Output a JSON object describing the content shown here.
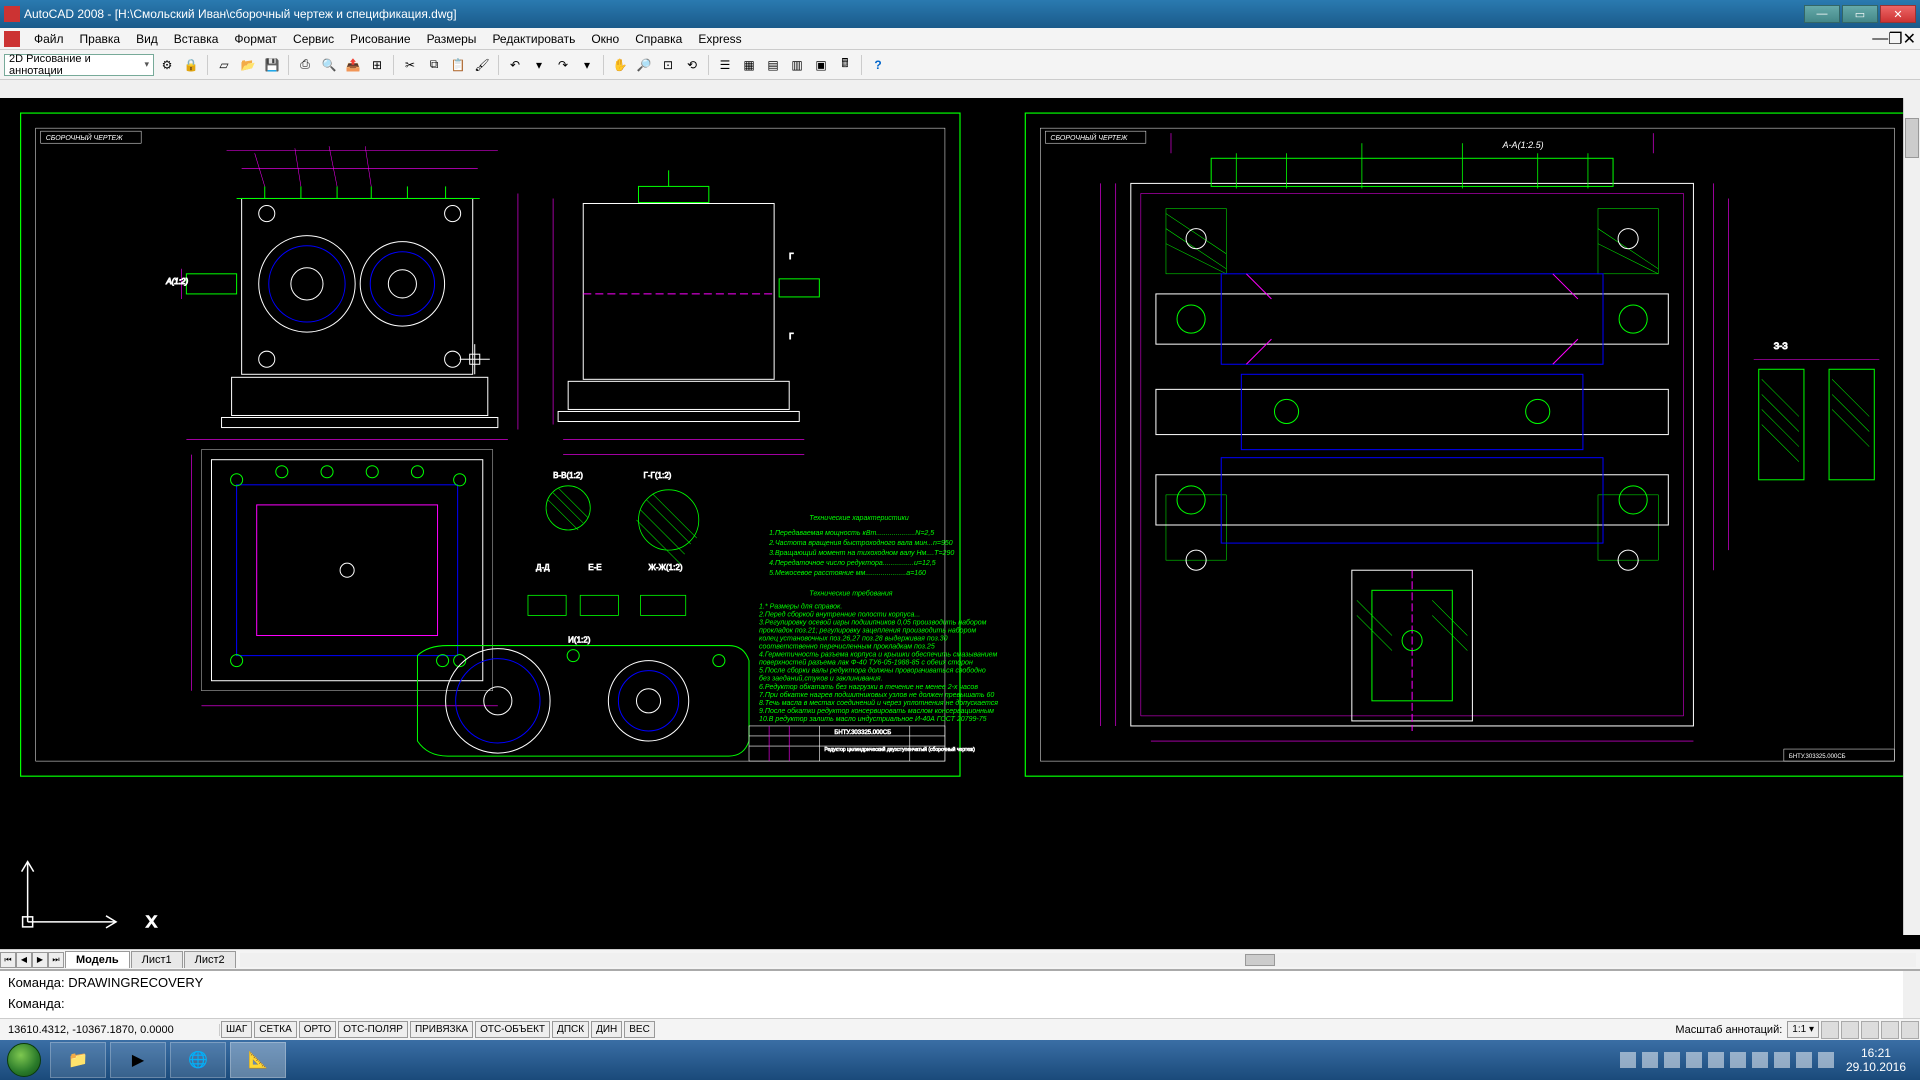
{
  "title": "AutoCAD 2008 - [H:\\Смольский Иван\\сборочный чертеж и спецификация.dwg]",
  "menu": [
    "Файл",
    "Правка",
    "Вид",
    "Вставка",
    "Формат",
    "Сервис",
    "Рисование",
    "Размеры",
    "Редактировать",
    "Окно",
    "Справка",
    "Express"
  ],
  "workspace_combo": "2D Рисование и аннотации",
  "tabs": {
    "items": [
      "Модель",
      "Лист1",
      "Лист2"
    ],
    "active": 0
  },
  "cmd": {
    "l1": "Команда: DRAWINGRECOVERY",
    "l2": "Команда:"
  },
  "status": {
    "coords": "13610.4312, -10367.1870, 0.0000",
    "toggles": [
      "ШАГ",
      "СЕТКА",
      "ОРТО",
      "ОТС-ПОЛЯР",
      "ПРИВЯЗКА",
      "ОТС-ОБЪЕКТ",
      "ДПСК",
      "ДИН",
      "ВЕС"
    ],
    "scale_label": "Масштаб аннотаций:",
    "scale_value": "1:1 ▾"
  },
  "drawing": {
    "sheet_label": "СБОРОЧНЫЙ ЧЕРТЕЖ",
    "tech_title": "Технические характеристики",
    "tech_req_title": "Технические требования",
    "title_block_ref": "БНТУ.303325.000СБ",
    "title_block_name": "Редуктор цилиндрический двухступенчатый (сборочный чертеж)",
    "sections": {
      "b": "В-В(1:2)",
      "g": "Г-Г(1:2)",
      "d": "Д-Д",
      "e": "Е-Е",
      "zh": "Ж-Ж(1:2)",
      "i": "И(1:2)",
      "a": "А-А(1:2.5)",
      "z": "З-З"
    }
  },
  "clock": {
    "time": "16:21",
    "date": "29.10.2016"
  }
}
